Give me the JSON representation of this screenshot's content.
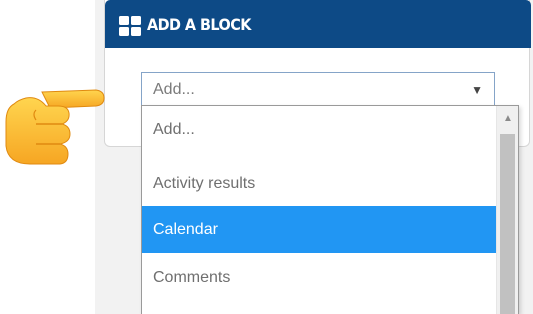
{
  "panel": {
    "title": "ADD A BLOCK",
    "header_color": "#0d4a86",
    "icon": "grid-icon"
  },
  "select": {
    "value": "Add...",
    "arrow": "▼",
    "options": [
      {
        "label": "Add...",
        "selected": false
      },
      {
        "label": "Activity results",
        "selected": false
      },
      {
        "label": "Calendar",
        "selected": true
      },
      {
        "label": "Comments",
        "selected": false
      }
    ],
    "selected_color": "#2196f3"
  },
  "scrollbar": {
    "up_arrow": "▲"
  },
  "pointer": {
    "icon": "pointing-hand-icon"
  }
}
